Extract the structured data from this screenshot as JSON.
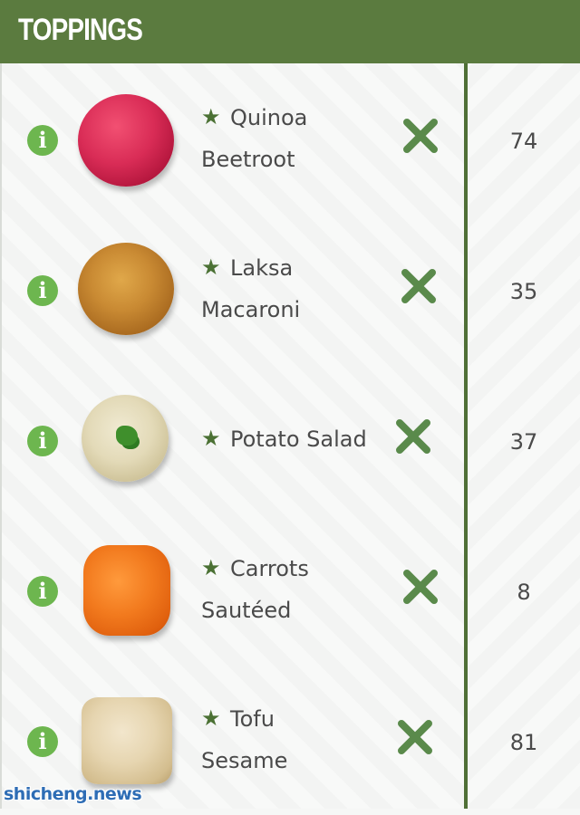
{
  "header": {
    "title": "TOPPINGS"
  },
  "rows": [
    {
      "name": "Quinoa",
      "sub": "Beetroot",
      "qty": "74",
      "thumb_icon": "beetroot-quinoa-image"
    },
    {
      "name": "Laksa",
      "sub": "Macaroni",
      "qty": "35",
      "thumb_icon": "laksa-macaroni-image"
    },
    {
      "name": "Potato Salad",
      "sub": "",
      "qty": "37",
      "thumb_icon": "potato-salad-image"
    },
    {
      "name": "Carrots",
      "sub": "Sautéed",
      "qty": "8",
      "thumb_icon": "sauteed-carrots-image"
    },
    {
      "name": "Tofu",
      "sub": "Sesame",
      "qty": "81",
      "thumb_icon": "sesame-tofu-image"
    }
  ],
  "icons": {
    "info": "i",
    "star": "★"
  },
  "colors": {
    "header": "#5b7b3f",
    "accent": "#4f6f36",
    "info": "#6db64f",
    "remove": "#5a8a4b"
  },
  "watermark": "shicheng.news"
}
